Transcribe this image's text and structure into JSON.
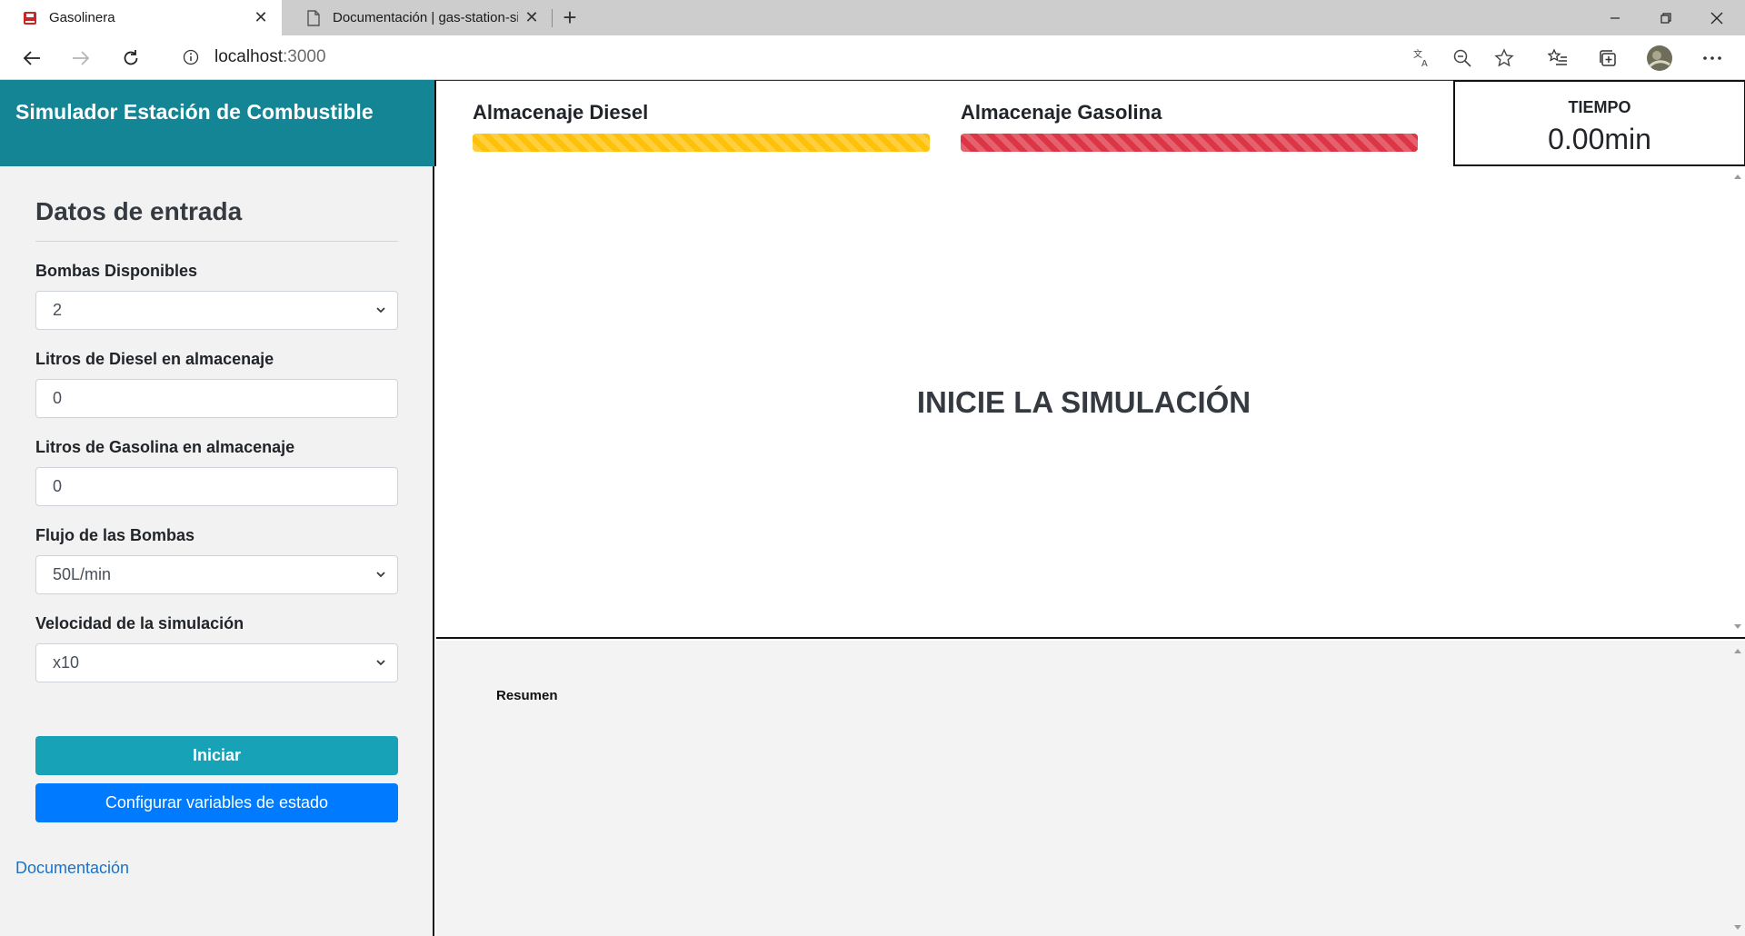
{
  "browser": {
    "tabs": [
      {
        "title": "Gasolinera",
        "active": true,
        "icon": "gas-pump-icon"
      },
      {
        "title": "Documentación | gas-station-sim",
        "active": false,
        "icon": "document-icon"
      }
    ],
    "url_host": "localhost",
    "url_port": ":3000"
  },
  "header": {
    "brand": "Simulador Estación de Combustible",
    "storage": {
      "diesel_label": "Almacenaje Diesel",
      "gas_label": "Almacenaje Gasolina",
      "diesel_fill": 1.0,
      "gas_fill": 1.0,
      "diesel_color": "#ffc107",
      "gas_color": "#dc3545"
    },
    "time_label": "TIEMPO",
    "time_value": "0.00min"
  },
  "sidebar": {
    "title": "Datos de entrada",
    "fields": [
      {
        "label": "Bombas Disponibles",
        "value": "2",
        "type": "select"
      },
      {
        "label": "Litros de Diesel en almacenaje",
        "value": "0",
        "type": "input"
      },
      {
        "label": "Litros de Gasolina en almacenaje",
        "value": "0",
        "type": "input"
      },
      {
        "label": "Flujo de las Bombas",
        "value": "50L/min",
        "type": "select"
      },
      {
        "label": "Velocidad de la simulación",
        "value": "x10",
        "type": "select"
      }
    ],
    "start_label": "Iniciar",
    "config_label": "Configurar variables de estado",
    "doc_link": "Documentación"
  },
  "main": {
    "message": "INICIE LA SIMULACIÓN",
    "summary_title": "Resumen"
  },
  "colors": {
    "brand_bg": "#148595",
    "start_button": "#17a2b8",
    "config_button": "#007bff"
  }
}
